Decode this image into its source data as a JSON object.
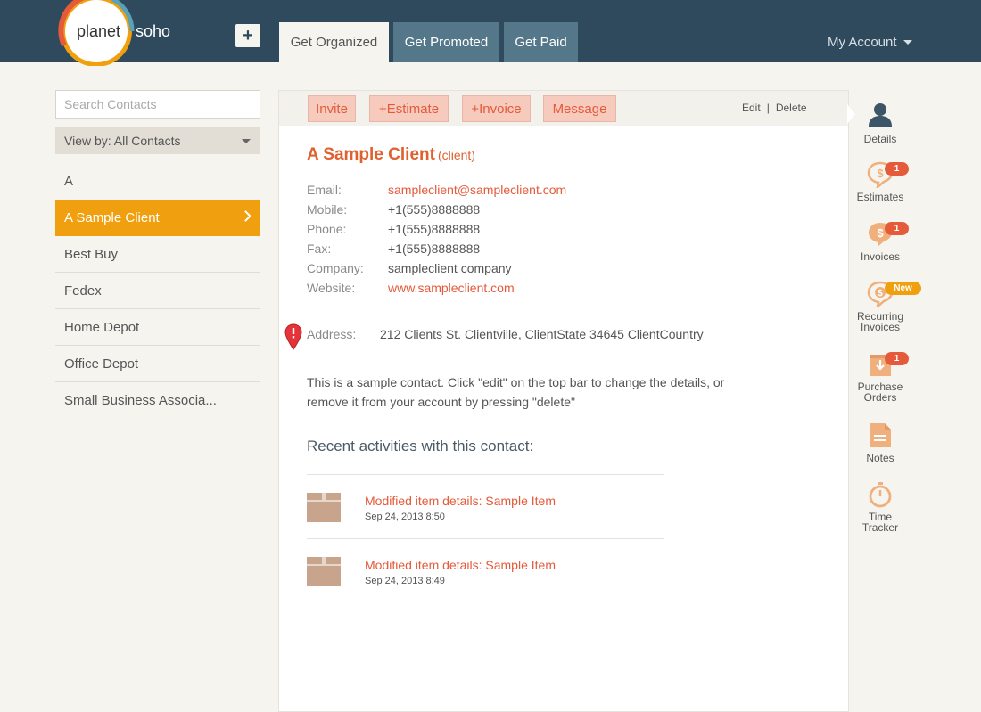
{
  "header": {
    "logo_left": "planet",
    "logo_right": "soho",
    "add_button": "+",
    "tabs": [
      {
        "label": "Get Organized"
      },
      {
        "label": "Get Promoted"
      },
      {
        "label": "Get Paid"
      }
    ],
    "account_label": "My Account"
  },
  "sidebar": {
    "search_placeholder": "Search Contacts",
    "view_by": "View by: All Contacts",
    "letter": "A",
    "contacts": [
      {
        "name": "A Sample Client"
      },
      {
        "name": "Best Buy"
      },
      {
        "name": "Fedex"
      },
      {
        "name": "Home Depot"
      },
      {
        "name": "Office Depot"
      },
      {
        "name": "Small Business Associa..."
      }
    ]
  },
  "actions": {
    "invite": "Invite",
    "estimate": "+Estimate",
    "invoice": "+Invoice",
    "message": "Message",
    "edit": "Edit",
    "separator": "|",
    "delete": "Delete"
  },
  "contact": {
    "name": "A Sample Client",
    "kind": "(client)",
    "fields": [
      {
        "label": "Email:",
        "value": "sampleclient@sampleclient.com"
      },
      {
        "label": "Mobile:",
        "value": "+1(555)8888888"
      },
      {
        "label": "Phone:",
        "value": "+1(555)8888888"
      },
      {
        "label": "Fax:",
        "value": "+1(555)8888888"
      },
      {
        "label": "Company:",
        "value": "sampleclient company"
      },
      {
        "label": "Website:",
        "value": "www.sampleclient.com"
      }
    ],
    "address_label": "Address:",
    "address_value": "212 Clients St. Clientville, ClientState 34645 ClientCountry",
    "description": "This is a sample contact. Click \"edit\" on the top bar to change the details, or remove it from your account by pressing \"delete\"",
    "recent_title": "Recent activities with this contact:",
    "activities": [
      {
        "title": "Modified item details: Sample Item",
        "date": "Sep 24, 2013 8:50"
      },
      {
        "title": "Modified item details: Sample Item",
        "date": "Sep 24, 2013 8:49"
      }
    ]
  },
  "right_nav": {
    "details": "Details",
    "estimates": "Estimates",
    "estimates_badge": "1",
    "invoices": "Invoices",
    "invoices_badge": "1",
    "recurring_line1": "Recurring",
    "recurring_line2": "Invoices",
    "recurring_badge": "New",
    "purchase_line1": "Purchase",
    "purchase_line2": "Orders",
    "purchase_badge": "1",
    "notes": "Notes",
    "time_line1": "Time",
    "time_line2": "Tracker"
  },
  "colors": {
    "header_bg": "#2e4a5c",
    "accent_orange": "#f0a00e",
    "accent_red": "#e45a3a",
    "icon_tan": "#c8a48c"
  }
}
